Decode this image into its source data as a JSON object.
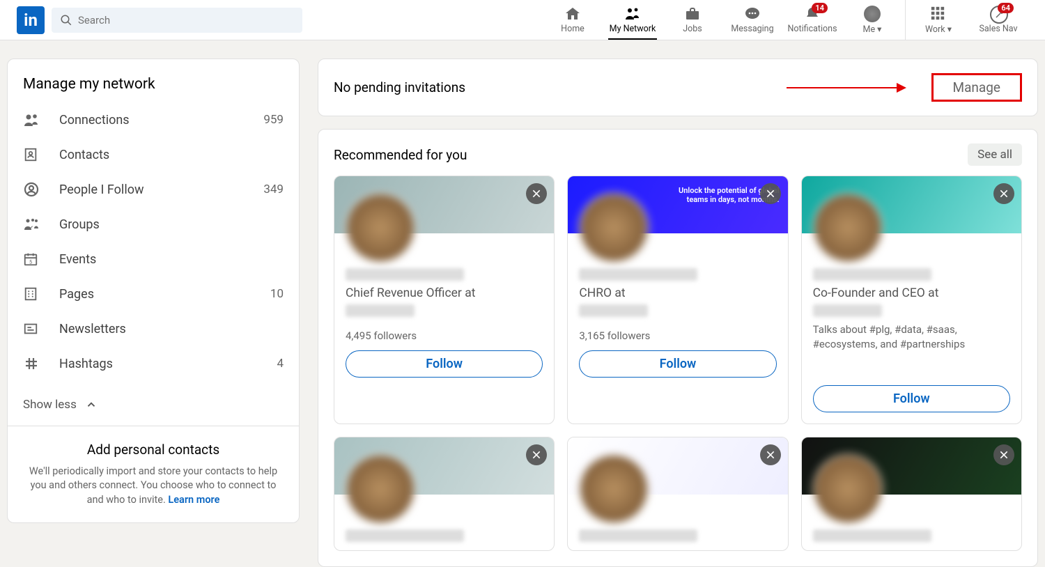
{
  "search_placeholder": "Search",
  "nav": {
    "home": "Home",
    "network": "My Network",
    "jobs": "Jobs",
    "messaging": "Messaging",
    "notifications": "Notifications",
    "me": "Me",
    "work": "Work",
    "sales": "Sales Nav",
    "notif_badge": "14",
    "sales_badge": "64"
  },
  "sidebar": {
    "title": "Manage my network",
    "items": [
      {
        "label": "Connections",
        "count": "959"
      },
      {
        "label": "Contacts",
        "count": ""
      },
      {
        "label": "People I Follow",
        "count": "349"
      },
      {
        "label": "Groups",
        "count": ""
      },
      {
        "label": "Events",
        "count": ""
      },
      {
        "label": "Pages",
        "count": "10"
      },
      {
        "label": "Newsletters",
        "count": ""
      },
      {
        "label": "Hashtags",
        "count": "4"
      }
    ],
    "show_less": "Show less",
    "contacts_title": "Add personal contacts",
    "contacts_text": "We'll periodically import and store your contacts to help you and others connect. You choose who to connect to and who to invite. ",
    "learn_more": "Learn more"
  },
  "invitations": {
    "text": "No pending invitations",
    "manage": "Manage"
  },
  "recommended": {
    "title": "Recommended for you",
    "see_all": "See all"
  },
  "cards": [
    {
      "subtitle": "Chief Revenue Officer at",
      "followers": "4,495 followers",
      "follow": "Follow"
    },
    {
      "subtitle": "CHRO at",
      "followers": "3,165 followers",
      "follow": "Follow",
      "cover_text": "Unlock the potential of global teams in days, not months."
    },
    {
      "subtitle": "Co-Founder and CEO at",
      "talks": "Talks about #plg, #data, #saas, #ecosystems, and #partnerships",
      "follow": "Follow"
    },
    {
      "subtitle": ""
    },
    {
      "subtitle": ""
    },
    {
      "subtitle": ""
    }
  ]
}
